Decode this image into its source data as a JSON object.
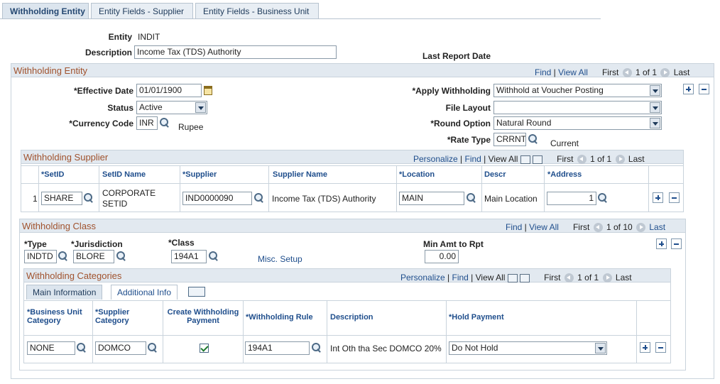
{
  "tabs": [
    {
      "label": "Withholding Entity"
    },
    {
      "label": "Entity Fields - Supplier"
    },
    {
      "label": "Entity Fields - Business Unit"
    }
  ],
  "entity": {
    "label": "Entity",
    "value": "INDIT"
  },
  "description": {
    "label": "Description",
    "value": "Income Tax (TDS) Authority"
  },
  "last_report_date_label": "Last Report Date",
  "withholding_entity": {
    "title": "Withholding Entity",
    "nav": {
      "find": "Find",
      "view_all": "View All",
      "first": "First",
      "range": "1 of 1",
      "last": "Last"
    },
    "effective_date": {
      "label": "*Effective Date",
      "value": "01/01/1900"
    },
    "status": {
      "label": "Status",
      "value": "Active"
    },
    "currency_code": {
      "label": "*Currency Code",
      "value": "INR",
      "desc": "Rupee"
    },
    "apply_withholding": {
      "label": "*Apply Withholding",
      "value": "Withhold at Voucher Posting"
    },
    "file_layout": {
      "label": "File Layout",
      "value": ""
    },
    "round_option": {
      "label": "*Round Option",
      "value": "Natural Round"
    },
    "rate_type": {
      "label": "*Rate Type",
      "value": "CRRNT",
      "desc": "Current"
    }
  },
  "withholding_supplier": {
    "title": "Withholding Supplier",
    "nav": {
      "personalize": "Personalize",
      "find": "Find",
      "view_all": "View All",
      "first": "First",
      "range": "1 of 1",
      "last": "Last"
    },
    "columns": [
      "*SetID",
      "SetID Name",
      "*Supplier",
      "Supplier Name",
      "*Location",
      "Descr",
      "*Address"
    ],
    "row": {
      "num": "1",
      "setid": "SHARE",
      "setid_name_1": "CORPORATE",
      "setid_name_2": "SETID",
      "supplier": "IND0000090",
      "supplier_name": "Income Tax (TDS) Authority",
      "location": "MAIN",
      "descr": "Main Location",
      "address": "1"
    }
  },
  "withholding_class": {
    "title": "Withholding Class",
    "nav": {
      "find": "Find",
      "view_all": "View All",
      "first": "First",
      "range": "1 of 10",
      "last": "Last"
    },
    "type": {
      "label": "*Type",
      "value": "INDTD"
    },
    "jurisdiction": {
      "label": "*Jurisdiction",
      "value": "BLORE"
    },
    "class": {
      "label": "*Class",
      "value": "194A1",
      "desc": "Misc. Setup"
    },
    "min_amt": {
      "label": "Min Amt to Rpt",
      "value": "0.00"
    }
  },
  "withholding_categories": {
    "title": "Withholding Categories",
    "nav": {
      "personalize": "Personalize",
      "find": "Find",
      "view_all": "View All",
      "first": "First",
      "range": "1 of 1",
      "last": "Last"
    },
    "subtabs": [
      "Main Information",
      "Additional Info"
    ],
    "columns": {
      "bu_category": [
        "*Business Unit",
        "Category"
      ],
      "supplier_category": [
        "*Supplier",
        "Category"
      ],
      "create_payment": [
        "Create Withholding",
        "Payment"
      ],
      "rule": "*Withholding Rule",
      "description": "Description",
      "hold_payment": "*Hold Payment"
    },
    "row": {
      "bu_category": "NONE",
      "supplier_category": "DOMCO",
      "rule": "194A1",
      "description": "Int Oth tha Sec DOMCO 20%",
      "hold_payment": "Do Not Hold"
    }
  }
}
